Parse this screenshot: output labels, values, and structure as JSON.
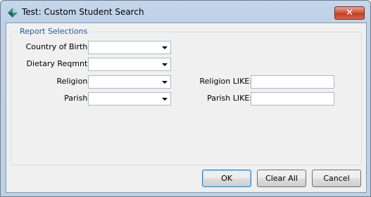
{
  "window": {
    "title": "Test: Custom Student Search",
    "close_label": "✕"
  },
  "group": {
    "legend": "Report Selections"
  },
  "fields": {
    "country_of_birth": {
      "label": "Country of Birth:",
      "value": ""
    },
    "dietary_reqmnt": {
      "label": "Dietary Reqmnt:",
      "value": ""
    },
    "religion": {
      "label": "Religion:",
      "value": ""
    },
    "parish": {
      "label": "Parish:",
      "value": ""
    },
    "religion_like": {
      "label": "Religion LIKE:",
      "value": ""
    },
    "parish_like": {
      "label": "Parish LIKE:",
      "value": ""
    }
  },
  "buttons": {
    "ok": "OK",
    "clear_all": "Clear All",
    "cancel": "Cancel"
  }
}
